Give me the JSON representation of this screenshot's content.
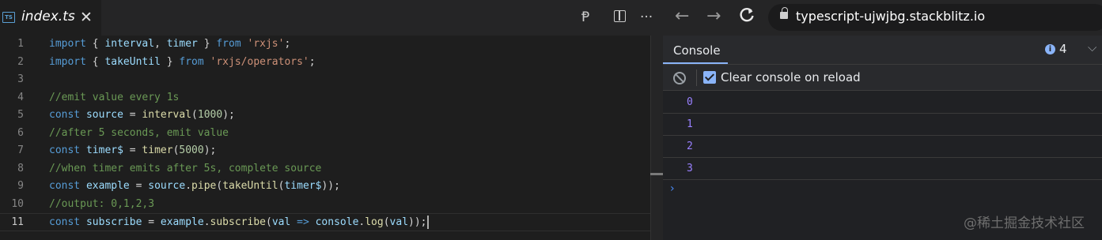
{
  "editor": {
    "tab": {
      "icon_text": "TS",
      "title": "index.ts",
      "close": "✕"
    },
    "actions": {
      "preview": "Ᵽ",
      "more": "···"
    },
    "lines": [
      {
        "n": "1",
        "tokens": [
          [
            "kw",
            "import"
          ],
          [
            "pun",
            " { "
          ],
          [
            "var",
            "interval"
          ],
          [
            "pun",
            ", "
          ],
          [
            "var",
            "timer"
          ],
          [
            "pun",
            " } "
          ],
          [
            "kw",
            "from"
          ],
          [
            "pun",
            " "
          ],
          [
            "str",
            "'rxjs'"
          ],
          [
            "pun",
            ";"
          ]
        ]
      },
      {
        "n": "2",
        "tokens": [
          [
            "kw",
            "import"
          ],
          [
            "pun",
            " { "
          ],
          [
            "var",
            "takeUntil"
          ],
          [
            "pun",
            " } "
          ],
          [
            "kw",
            "from"
          ],
          [
            "pun",
            " "
          ],
          [
            "str",
            "'rxjs/operators'"
          ],
          [
            "pun",
            ";"
          ]
        ]
      },
      {
        "n": "3",
        "tokens": []
      },
      {
        "n": "4",
        "tokens": [
          [
            "cmt",
            "//emit value every 1s"
          ]
        ]
      },
      {
        "n": "5",
        "tokens": [
          [
            "kw",
            "const"
          ],
          [
            "pun",
            " "
          ],
          [
            "var",
            "source"
          ],
          [
            "pun",
            " = "
          ],
          [
            "fn",
            "interval"
          ],
          [
            "pun",
            "("
          ],
          [
            "num",
            "1000"
          ],
          [
            "pun",
            ");"
          ]
        ]
      },
      {
        "n": "6",
        "tokens": [
          [
            "cmt",
            "//after 5 seconds, emit value"
          ]
        ]
      },
      {
        "n": "7",
        "tokens": [
          [
            "kw",
            "const"
          ],
          [
            "pun",
            " "
          ],
          [
            "var",
            "timer$"
          ],
          [
            "pun",
            " = "
          ],
          [
            "fn",
            "timer"
          ],
          [
            "pun",
            "("
          ],
          [
            "num",
            "5000"
          ],
          [
            "pun",
            ");"
          ]
        ]
      },
      {
        "n": "8",
        "tokens": [
          [
            "cmt",
            "//when timer emits after 5s, complete source"
          ]
        ]
      },
      {
        "n": "9",
        "tokens": [
          [
            "kw",
            "const"
          ],
          [
            "pun",
            " "
          ],
          [
            "var",
            "example"
          ],
          [
            "pun",
            " = "
          ],
          [
            "var",
            "source"
          ],
          [
            "pun",
            "."
          ],
          [
            "fn",
            "pipe"
          ],
          [
            "pun",
            "("
          ],
          [
            "fn",
            "takeUntil"
          ],
          [
            "pun",
            "("
          ],
          [
            "var",
            "timer$"
          ],
          [
            "pun",
            "));"
          ]
        ]
      },
      {
        "n": "10",
        "tokens": [
          [
            "cmt",
            "//output: 0,1,2,3"
          ]
        ]
      },
      {
        "n": "11",
        "tokens": [
          [
            "kw",
            "const"
          ],
          [
            "pun",
            " "
          ],
          [
            "var",
            "subscribe"
          ],
          [
            "pun",
            " = "
          ],
          [
            "var",
            "example"
          ],
          [
            "pun",
            "."
          ],
          [
            "fn",
            "subscribe"
          ],
          [
            "pun",
            "("
          ],
          [
            "var",
            "val"
          ],
          [
            "pun",
            " "
          ],
          [
            "kw",
            "=>"
          ],
          [
            "pun",
            " "
          ],
          [
            "var",
            "console"
          ],
          [
            "pun",
            "."
          ],
          [
            "fn",
            "log"
          ],
          [
            "pun",
            "("
          ],
          [
            "var",
            "val"
          ],
          [
            "pun",
            "));"
          ]
        ]
      }
    ],
    "active_line": "11"
  },
  "browser": {
    "nav": {
      "back": "←",
      "forward": "→",
      "reload": "C"
    },
    "url": "typescript-ujwjbg.stackblitz.io",
    "console": {
      "tab_label": "Console",
      "info_count": "4",
      "info_icon": "i",
      "chevron": "⌵",
      "clear_label": "Clear console on reload",
      "logs": [
        "0",
        "1",
        "2",
        "3"
      ],
      "prompt": "›"
    }
  },
  "watermark": "@稀土掘金技术社区",
  "colors": {
    "keyword": "#569cd6",
    "string": "#ce9178",
    "variable": "#9cdcfe",
    "function": "#dcdcaa",
    "comment": "#6a9955",
    "number": "#b5cea8",
    "log_value": "#9980ff",
    "accent": "#8ab4f8"
  }
}
